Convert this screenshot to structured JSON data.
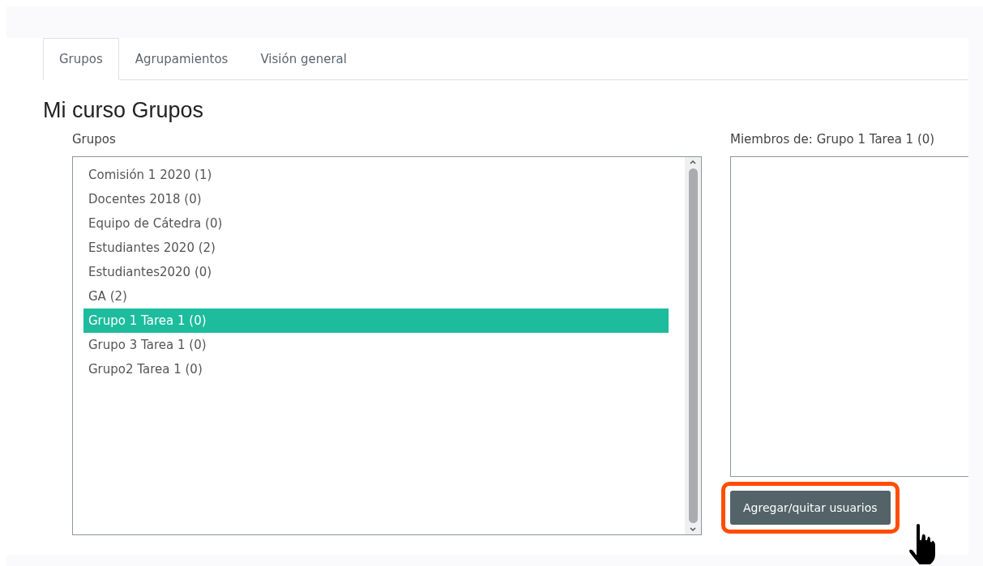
{
  "tabs": [
    {
      "label": "Grupos",
      "selected": true
    },
    {
      "label": "Agrupamientos",
      "selected": false
    },
    {
      "label": "Visión general",
      "selected": false
    }
  ],
  "heading": "Mi curso Grupos",
  "groups": {
    "label": "Grupos",
    "items": [
      {
        "label": "Comisión 1 2020 (1)",
        "selected": false
      },
      {
        "label": "Docentes 2018 (0)",
        "selected": false
      },
      {
        "label": "Equipo de Cátedra (0)",
        "selected": false
      },
      {
        "label": "Estudiantes 2020 (2)",
        "selected": false
      },
      {
        "label": "Estudiantes2020 (0)",
        "selected": false
      },
      {
        "label": "GA (2)",
        "selected": false
      },
      {
        "label": "Grupo 1 Tarea 1 (0)",
        "selected": true
      },
      {
        "label": "Grupo 3 Tarea 1 (0)",
        "selected": false
      },
      {
        "label": "Grupo2 Tarea 1 (0)",
        "selected": false
      }
    ]
  },
  "members": {
    "label": "Miembros de: Grupo 1 Tarea 1 (0)"
  },
  "action_button": {
    "label": "Agregar/quitar usuarios",
    "highlighted": true
  }
}
